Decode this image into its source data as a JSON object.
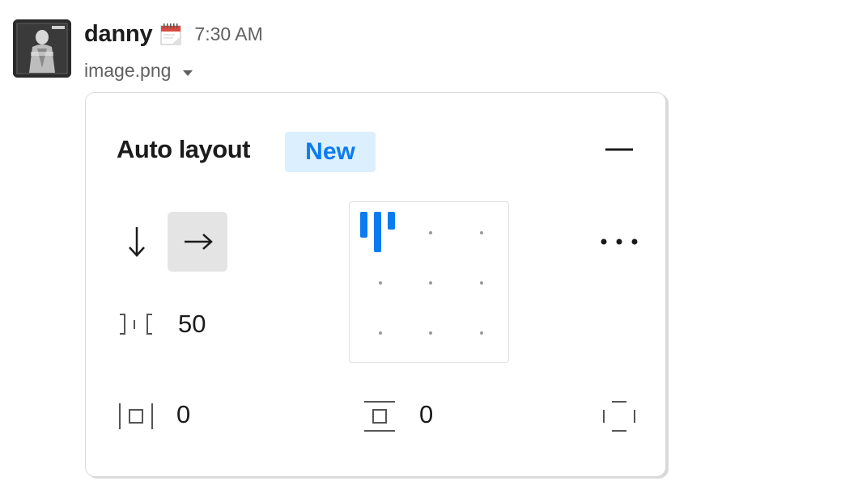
{
  "message": {
    "username": "danny",
    "status_emoji": "calendar-spiral-icon",
    "timestamp": "7:30 AM",
    "attachment_name": "image.png"
  },
  "panel": {
    "title": "Auto layout",
    "badge": "New",
    "spacing_between": "50",
    "horizontal_padding": "0",
    "vertical_padding": "0",
    "direction_selected": "horizontal",
    "alignment_selected": "top-left"
  },
  "colors": {
    "accent_blue": "#0b7cf0",
    "badge_bg": "#dcefff",
    "selected_bg": "#e4e4e4",
    "text_dark": "#1b1b1b",
    "text_muted": "#616061"
  }
}
